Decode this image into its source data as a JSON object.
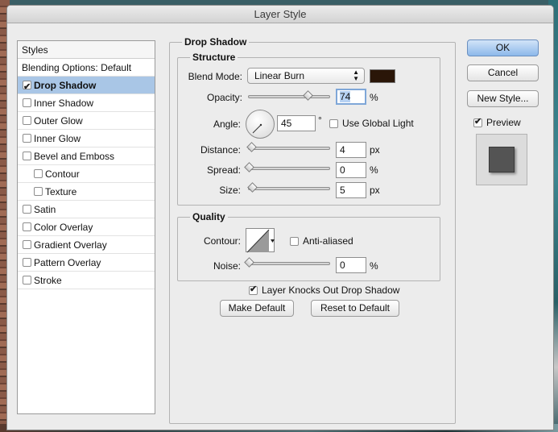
{
  "window": {
    "title": "Layer Style"
  },
  "styles": {
    "header": "Styles",
    "blending_options": "Blending Options: Default",
    "items": [
      {
        "label": "Drop Shadow",
        "checked": true,
        "selected": true,
        "indent": false
      },
      {
        "label": "Inner Shadow",
        "checked": false,
        "selected": false,
        "indent": false
      },
      {
        "label": "Outer Glow",
        "checked": false,
        "selected": false,
        "indent": false
      },
      {
        "label": "Inner Glow",
        "checked": false,
        "selected": false,
        "indent": false
      },
      {
        "label": "Bevel and Emboss",
        "checked": false,
        "selected": false,
        "indent": false
      },
      {
        "label": "Contour",
        "checked": false,
        "selected": false,
        "indent": true
      },
      {
        "label": "Texture",
        "checked": false,
        "selected": false,
        "indent": true
      },
      {
        "label": "Satin",
        "checked": false,
        "selected": false,
        "indent": false
      },
      {
        "label": "Color Overlay",
        "checked": false,
        "selected": false,
        "indent": false
      },
      {
        "label": "Gradient Overlay",
        "checked": false,
        "selected": false,
        "indent": false
      },
      {
        "label": "Pattern Overlay",
        "checked": false,
        "selected": false,
        "indent": false
      },
      {
        "label": "Stroke",
        "checked": false,
        "selected": false,
        "indent": false
      }
    ]
  },
  "drop_shadow": {
    "section_title": "Drop Shadow",
    "structure": {
      "title": "Structure",
      "blend_mode_label": "Blend Mode:",
      "blend_mode_value": "Linear Burn",
      "shadow_color": "#2a1608",
      "opacity_label": "Opacity:",
      "opacity_value": "74",
      "opacity_unit": "%",
      "opacity_fraction": 0.74,
      "angle_label": "Angle:",
      "angle_value": "45",
      "angle_unit": "°",
      "use_global_light_label": "Use Global Light",
      "use_global_light_checked": false,
      "distance_label": "Distance:",
      "distance_value": "4",
      "distance_unit": "px",
      "spread_label": "Spread:",
      "spread_value": "0",
      "spread_unit": "%",
      "size_label": "Size:",
      "size_value": "5",
      "size_unit": "px"
    },
    "quality": {
      "title": "Quality",
      "contour_label": "Contour:",
      "anti_aliased_label": "Anti-aliased",
      "anti_aliased_checked": false,
      "noise_label": "Noise:",
      "noise_value": "0",
      "noise_unit": "%"
    },
    "knocks_out_label": "Layer Knocks Out Drop Shadow",
    "knocks_out_checked": true,
    "make_default_label": "Make Default",
    "reset_default_label": "Reset to Default"
  },
  "actions": {
    "ok_label": "OK",
    "cancel_label": "Cancel",
    "new_style_label": "New Style...",
    "preview_label": "Preview",
    "preview_checked": true
  },
  "colors": {
    "selection": "#a9c6e6",
    "default_button": "#8db8ea"
  }
}
